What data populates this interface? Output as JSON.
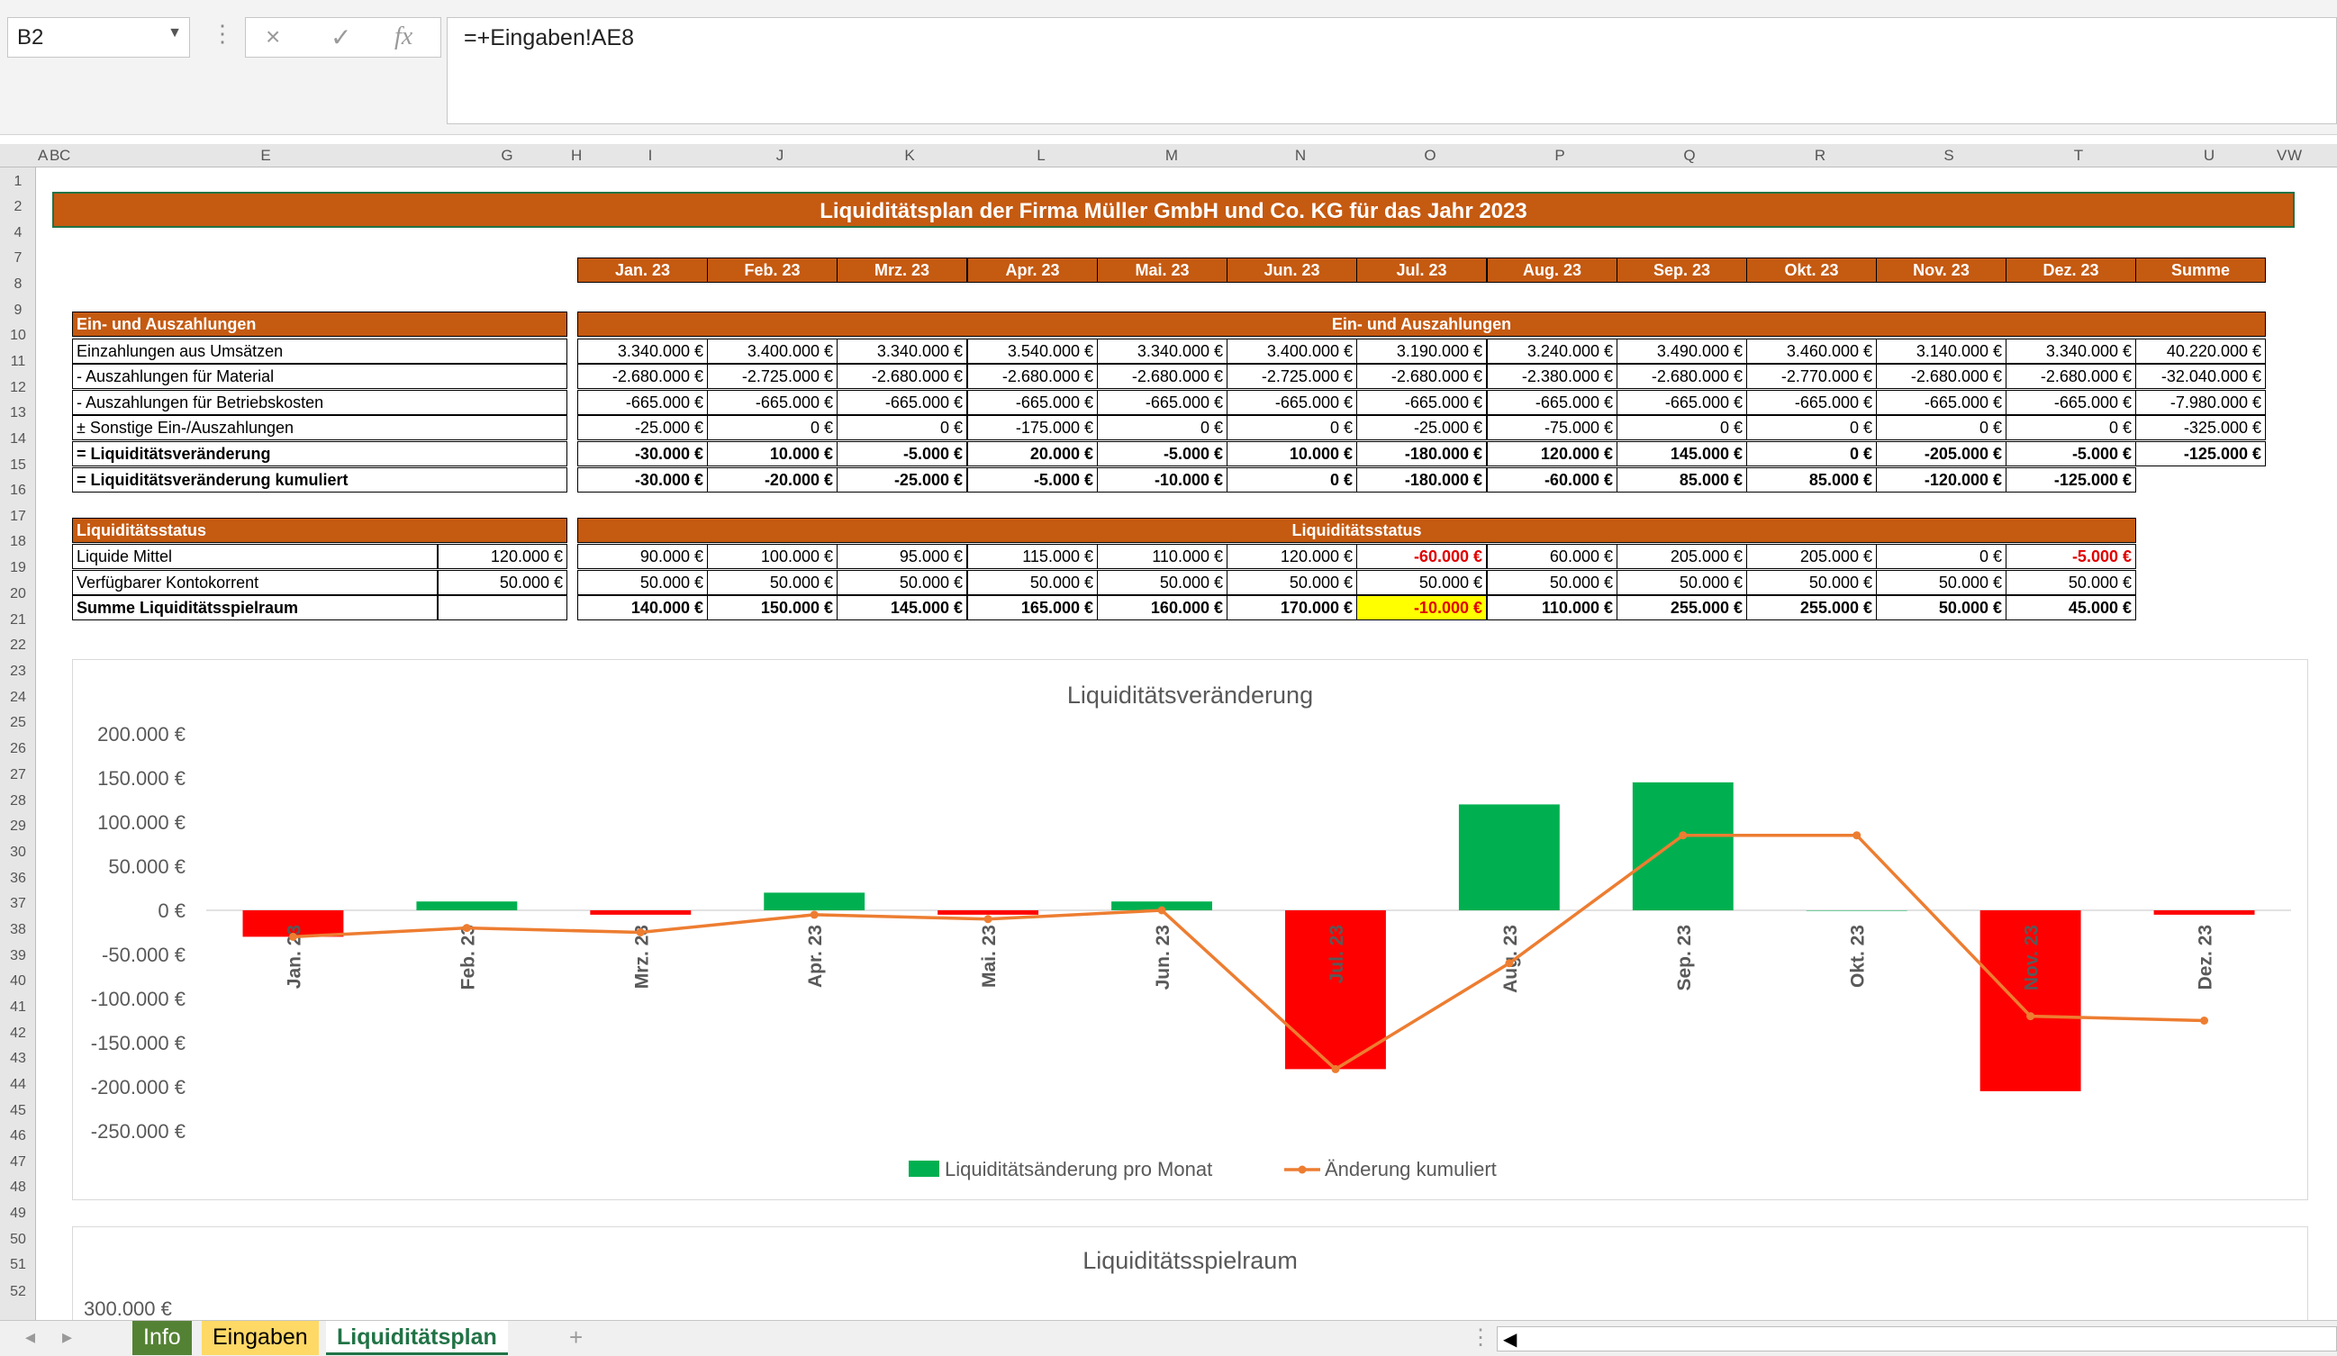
{
  "formula_bar": {
    "name_box": "B2",
    "formula": "=+Eingaben!AE8",
    "cancel_icon": "×",
    "enter_icon": "✓",
    "fx": "fx"
  },
  "columns": [
    "A",
    "B",
    "C",
    "E",
    "G",
    "H",
    "I",
    "J",
    "K",
    "L",
    "M",
    "N",
    "O",
    "P",
    "Q",
    "R",
    "S",
    "T",
    "U",
    "V",
    "W"
  ],
  "rows": [
    "1",
    "2",
    "4",
    "7",
    "8",
    "9",
    "10",
    "11",
    "12",
    "13",
    "14",
    "15",
    "16",
    "17",
    "18",
    "19",
    "20",
    "21",
    "22",
    "23",
    "24",
    "25",
    "26",
    "27",
    "28",
    "29",
    "30",
    "36",
    "37",
    "38",
    "39",
    "40",
    "41",
    "42",
    "43",
    "44",
    "45",
    "46",
    "47",
    "48",
    "49",
    "50",
    "51",
    "52"
  ],
  "sheet": {
    "title": "Liquiditätsplan der Firma Müller GmbH und Co. KG für das Jahr 2023",
    "months": [
      "Jan. 23",
      "Feb. 23",
      "Mrz. 23",
      "Apr. 23",
      "Mai. 23",
      "Jun. 23",
      "Jul. 23",
      "Aug. 23",
      "Sep. 23",
      "Okt. 23",
      "Nov. 23",
      "Dez. 23",
      "Summe"
    ],
    "flows": {
      "left_header": "Ein- und Auszahlungen",
      "right_header": "Ein- und Auszahlungen",
      "rows": [
        {
          "label": "Einzahlungen aus Umsätzen",
          "bold": false,
          "values": [
            "3.340.000 €",
            "3.400.000 €",
            "3.340.000 €",
            "3.540.000 €",
            "3.340.000 €",
            "3.400.000 €",
            "3.190.000 €",
            "3.240.000 €",
            "3.490.000 €",
            "3.460.000 €",
            "3.140.000 €",
            "3.340.000 €",
            "40.220.000 €"
          ]
        },
        {
          "label": "- Auszahlungen für Material",
          "bold": false,
          "values": [
            "-2.680.000 €",
            "-2.725.000 €",
            "-2.680.000 €",
            "-2.680.000 €",
            "-2.680.000 €",
            "-2.725.000 €",
            "-2.680.000 €",
            "-2.380.000 €",
            "-2.680.000 €",
            "-2.770.000 €",
            "-2.680.000 €",
            "-2.680.000 €",
            "-32.040.000 €"
          ]
        },
        {
          "label": "- Auszahlungen für Betriebskosten",
          "bold": false,
          "values": [
            "-665.000 €",
            "-665.000 €",
            "-665.000 €",
            "-665.000 €",
            "-665.000 €",
            "-665.000 €",
            "-665.000 €",
            "-665.000 €",
            "-665.000 €",
            "-665.000 €",
            "-665.000 €",
            "-665.000 €",
            "-7.980.000 €"
          ]
        },
        {
          "label": "± Sonstige Ein-/Auszahlungen",
          "bold": false,
          "values": [
            "-25.000 €",
            "0 €",
            "0 €",
            "-175.000 €",
            "0 €",
            "0 €",
            "-25.000 €",
            "-75.000 €",
            "0 €",
            "0 €",
            "0 €",
            "0 €",
            "-325.000 €"
          ]
        },
        {
          "label": "= Liquiditätsveränderung",
          "bold": true,
          "values": [
            "-30.000 €",
            "10.000 €",
            "-5.000 €",
            "20.000 €",
            "-5.000 €",
            "10.000 €",
            "-180.000 €",
            "120.000 €",
            "145.000 €",
            "0 €",
            "-205.000 €",
            "-5.000 €",
            "-125.000 €"
          ]
        },
        {
          "label": "= Liquiditätsveränderung kumuliert",
          "bold": true,
          "values": [
            "-30.000 €",
            "-20.000 €",
            "-25.000 €",
            "-5.000 €",
            "-10.000 €",
            "0 €",
            "-180.000 €",
            "-60.000 €",
            "85.000 €",
            "85.000 €",
            "-120.000 €",
            "-125.000 €"
          ]
        }
      ]
    },
    "status": {
      "left_header": "Liquiditätsstatus",
      "right_header": "Liquiditätsstatus",
      "rows": [
        {
          "label": "Liquide Mittel",
          "input": "120.000 €",
          "values": [
            "90.000 €",
            "100.000 €",
            "95.000 €",
            "115.000 €",
            "110.000 €",
            "120.000 €",
            "-60.000 €",
            "60.000 €",
            "205.000 €",
            "205.000 €",
            "0 €",
            "-5.000 €"
          ]
        },
        {
          "label": "Verfügbarer Kontokorrent",
          "input": "50.000 €",
          "values": [
            "50.000 €",
            "50.000 €",
            "50.000 €",
            "50.000 €",
            "50.000 €",
            "50.000 €",
            "50.000 €",
            "50.000 €",
            "50.000 €",
            "50.000 €",
            "50.000 €",
            "50.000 €"
          ]
        },
        {
          "label": "Summe Liquiditätsspielraum",
          "input": "",
          "values": [
            "140.000 €",
            "150.000 €",
            "145.000 €",
            "165.000 €",
            "160.000 €",
            "170.000 €",
            "-10.000 €",
            "110.000 €",
            "255.000 €",
            "255.000 €",
            "50.000 €",
            "45.000 €"
          ]
        }
      ]
    }
  },
  "chart_data": [
    {
      "type": "bar",
      "title": "Liquiditätsveränderung",
      "categories": [
        "Jan. 23",
        "Feb. 23",
        "Mrz. 23",
        "Apr. 23",
        "Mai. 23",
        "Jun. 23",
        "Jul. 23",
        "Aug. 23",
        "Sep. 23",
        "Okt. 23",
        "Nov. 23",
        "Dez. 23"
      ],
      "series": [
        {
          "name": "Liquiditätsänderung pro Monat",
          "kind": "bar",
          "color_pos": "#00b050",
          "color_neg": "#ff0000",
          "values": [
            -30000,
            10000,
            -5000,
            20000,
            -5000,
            10000,
            -180000,
            120000,
            145000,
            0,
            -205000,
            -5000
          ]
        },
        {
          "name": "Änderung kumuliert",
          "kind": "line",
          "color": "#ed7d31",
          "values": [
            -30000,
            -20000,
            -25000,
            -5000,
            -10000,
            0,
            -180000,
            -60000,
            85000,
            85000,
            -120000,
            -125000
          ]
        }
      ],
      "ylim": [
        -250000,
        200000
      ],
      "yticks": [
        "200.000 €",
        "150.000 €",
        "100.000 €",
        "50.000 €",
        "0 €",
        "-50.000 €",
        "-100.000 €",
        "-150.000 €",
        "-200.000 €",
        "-250.000 €"
      ],
      "legend": "bottom"
    },
    {
      "type": "bar",
      "title": "Liquiditätsspielraum",
      "yticks": [
        "300.000 €"
      ]
    }
  ],
  "tabs": {
    "items": [
      "Info",
      "Eingaben",
      "Liquiditätsplan"
    ],
    "active": "Liquiditätsplan",
    "add_icon": "+"
  },
  "colors": {
    "header": "#c55a11",
    "accent": "#217346",
    "negative": "#e00000",
    "highlight": "#ffff00"
  }
}
